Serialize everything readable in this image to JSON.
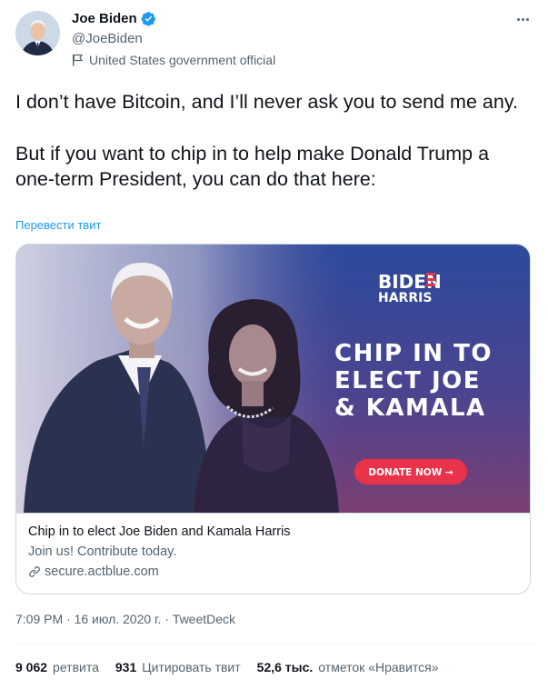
{
  "author": {
    "name": "Joe Biden",
    "handle": "@JoeBiden",
    "label": "United States government official"
  },
  "tweet": {
    "text_p1": "I don’t have Bitcoin, and I’ll never ask you to send me any.",
    "text_p2": "But if you want to chip in to help make Donald Trump a one-term President, you can do that here:",
    "translate": "Перевести твит"
  },
  "card": {
    "logo_line1": "BIDEN",
    "logo_line2": "HARRIS",
    "headline_line1": "CHIP IN TO",
    "headline_line2": "ELECT JOE",
    "headline_line3": "& KAMALA",
    "donate_button": "DONATE NOW →",
    "title": "Chip in to elect Joe Biden and Kamala Harris",
    "description": "Join us! Contribute today.",
    "domain": "secure.actblue.com"
  },
  "meta": {
    "time": "7:09 PM",
    "date": "16 июл. 2020 г.",
    "source": "TweetDeck",
    "separator": "·"
  },
  "stats": {
    "retweets_count": "9 062",
    "retweets_label": "ретвита",
    "quotes_count": "931",
    "quotes_label": "Цитировать твит",
    "likes_count": "52,6 тыс.",
    "likes_label": "отметок «Нравится»"
  },
  "colors": {
    "link_blue": "#1d9bf0",
    "verified_blue": "#1d9bf0",
    "card_bg_top": "#2c4a9c",
    "card_bg_bottom": "#7b3f74",
    "donate_red": "#e8334a"
  },
  "icons": {
    "verified": "verified-badge-icon",
    "flag": "government-flag-icon",
    "more": "more-dots-icon",
    "link": "link-icon"
  }
}
